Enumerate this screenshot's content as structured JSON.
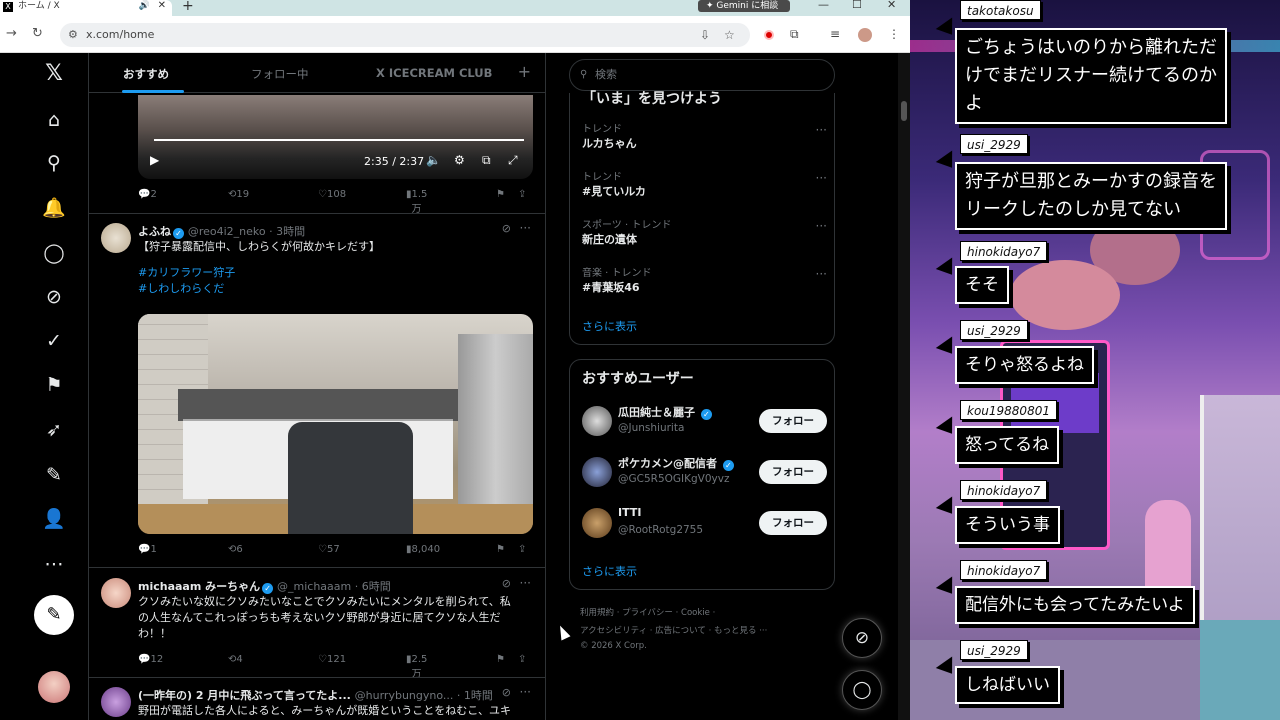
{
  "browser": {
    "tab_title": "ホーム / X",
    "url": "x.com/home",
    "gemini_label": "Gemini に相談"
  },
  "nav": {
    "icons": [
      "x-logo",
      "home",
      "search",
      "notifications",
      "messages",
      "grok",
      "verified",
      "bookmarks",
      "premium",
      "articles",
      "profile",
      "more"
    ]
  },
  "feed": {
    "tabs": [
      "おすすめ",
      "フォロー中",
      "X ICECREAM CLUB"
    ],
    "video": {
      "time": "2:35 / 2:37"
    },
    "post0_actions": {
      "replies": "2",
      "reposts": "19",
      "likes": "108",
      "views": "1.5万"
    },
    "posts": [
      {
        "name": "よふね",
        "handle": "@reo4i2_neko · 3時間",
        "line1": "【狩子暴露配信中、しわらくが何故かキレだす】",
        "tag1": "#カリフラワー狩子",
        "tag2": "#しわしわらくだ",
        "replies": "1",
        "reposts": "6",
        "likes": "57",
        "views": "8,040"
      },
      {
        "name": "michaaam みーちゃん",
        "handle": "@_michaaam · 6時間",
        "line1": "クソみたいな奴にクソみたいなことでクソみたいにメンタルを削られて、私",
        "line2": "の人生なんてこれっぽっちも考えないクソ野郎が身近に居てクソな人生だ",
        "line3": "わ！！",
        "replies": "12",
        "reposts": "4",
        "likes": "121",
        "views": "2.5万"
      },
      {
        "name": "(一昨年の) 2 月中に飛ぶって言ってたよ...",
        "handle": "@hurrybungyno... · 1時間",
        "line1": "野田が電話した各人によると、みーちゃんが既婚ということをねむこ、ユキ"
      }
    ]
  },
  "sidebar": {
    "search_placeholder": "検索",
    "trends_title": "「いま」を見つけよう",
    "trends": [
      {
        "category": "トレンド",
        "name": "ルカちゃん"
      },
      {
        "category": "トレンド",
        "name": "#見ていルカ"
      },
      {
        "category": "スポーツ · トレンド",
        "name": "新庄の遺体"
      },
      {
        "category": "音楽 · トレンド",
        "name": "#青葉坂46"
      }
    ],
    "show_more": "さらに表示",
    "users_title": "おすすめユーザー",
    "users": [
      {
        "name": "瓜田純士＆麗子",
        "handle": "@Junshiurita"
      },
      {
        "name": "ポケカメン@配信者",
        "handle": "@GC5R5OGIKgV0yvz"
      },
      {
        "name": "ITTI",
        "handle": "@RootRotg2755"
      }
    ],
    "follow_label": "フォロー",
    "footer1": "利用規約  ·  プライバシー  ·  Cookie  ·",
    "footer2": "アクセシビリティ  ·  広告について  ·  もっと見る ···",
    "footer3": "© 2026 X Corp."
  },
  "stream_chat": [
    {
      "user": "takotakosu",
      "msg1": "ごちょうはいのりから離れただ",
      "msg2": "けでまだリスナー続けてるのか",
      "msg3": "よ"
    },
    {
      "user": "usi_2929",
      "msg1": "狩子が旦那とみーかすの録音を",
      "msg2": "リークしたのしか見てない"
    },
    {
      "user": "hinokidayo7",
      "msg1": "そそ"
    },
    {
      "user": "usi_2929",
      "msg1": "そりゃ怒るよね"
    },
    {
      "user": "kou19880801",
      "msg1": "怒ってるね"
    },
    {
      "user": "hinokidayo7",
      "msg1": "そういう事"
    },
    {
      "user": "hinokidayo7",
      "msg1": "配信外にも会ってたみたいよ"
    },
    {
      "user": "usi_2929",
      "msg1": "しねばいい"
    }
  ]
}
